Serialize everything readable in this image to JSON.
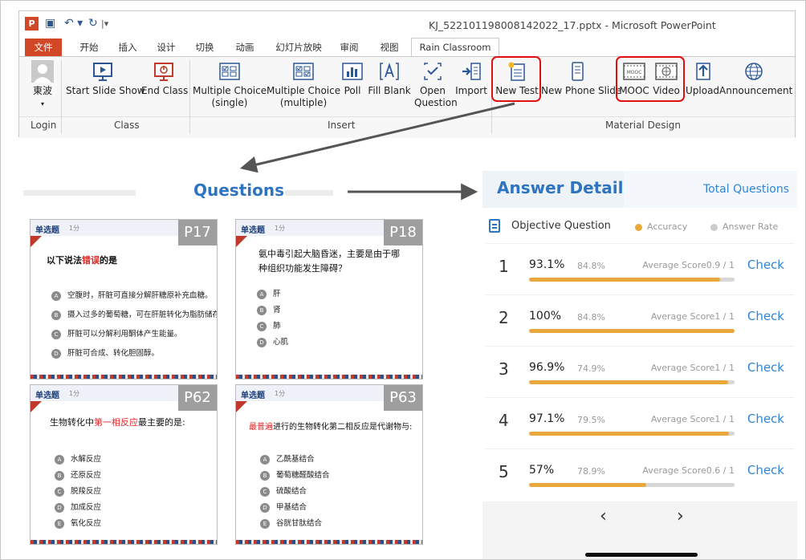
{
  "window": {
    "app_icon": "P",
    "title": "KJ_522101198008142022_17.pptx - Microsoft PowerPoint",
    "qa_save": "▣",
    "qa_undo": "↶ ▾",
    "qa_redo": "↻",
    "qa_more": "|▾"
  },
  "tabs": [
    "文件",
    "开始",
    "插入",
    "设计",
    "切换",
    "动画",
    "幻灯片放映",
    "审阅",
    "视图",
    "Rain Classroom"
  ],
  "ribbon": {
    "login_name": "東波",
    "login_arrow": "▾",
    "buttons": {
      "start_slide_show": "Start Slide Show",
      "end_class": "End Class",
      "mc_single_1": "Multiple Choice",
      "mc_single_2": "(single)",
      "mc_multiple_1": "Multiple Choice",
      "mc_multiple_2": "(multiple)",
      "poll": "Poll",
      "fill_blank": "Fill Blank",
      "open_question_1": "Open",
      "open_question_2": "Question",
      "import": "Import",
      "new_test": "New Test",
      "new_phone_slide": "New Phone Slide",
      "mooc": "MOOC",
      "video": "Video",
      "upload": "Upload",
      "announcement": "Announcement"
    },
    "groups": {
      "login": "Login",
      "class": "Class",
      "insert": "Insert",
      "material_design": "Material Design"
    }
  },
  "questions": {
    "title": "Questions",
    "slides": [
      {
        "tag": "P17",
        "type": "单选题",
        "score": "1分",
        "question_pre": "以下说法",
        "question_red": "错误",
        "question_post": "的是",
        "options": [
          {
            "letter": "A",
            "text": "空腹时，肝脏可直接分解肝糖原补充血糖。"
          },
          {
            "letter": "B",
            "text": "摄入过多的葡萄糖，可在肝脏转化为脂肪储存。"
          },
          {
            "letter": "C",
            "text": "肝脏可以分解利用酮体产生能量。"
          },
          {
            "letter": "D",
            "text": "肝脏可合成、转化胆固醇。"
          }
        ]
      },
      {
        "tag": "P18",
        "type": "单选题",
        "score": "1分",
        "question_pre": "氨中毒引起大脑昏迷，主要是由于哪种组织功能发生障碍？",
        "question_red": "",
        "question_post": "",
        "options": [
          {
            "letter": "A",
            "text": "肝"
          },
          {
            "letter": "B",
            "text": "肾"
          },
          {
            "letter": "C",
            "text": "肺"
          },
          {
            "letter": "D",
            "text": "心肌"
          }
        ]
      },
      {
        "tag": "P62",
        "type": "单选题",
        "score": "1分",
        "question_pre": "生物转化中",
        "question_red": "第一相反应",
        "question_post": "最主要的是:",
        "options": [
          {
            "letter": "A",
            "text": "水解反应"
          },
          {
            "letter": "B",
            "text": "还原反应"
          },
          {
            "letter": "C",
            "text": "脱羧反应"
          },
          {
            "letter": "D",
            "text": "加成反应"
          },
          {
            "letter": "E",
            "text": "氧化反应"
          }
        ]
      },
      {
        "tag": "P63",
        "type": "单选题",
        "score": "1分",
        "question_pre": "",
        "question_red": "最普遍",
        "question_post": "进行的生物转化第二相反应是代谢物与:",
        "options": [
          {
            "letter": "A",
            "text": "乙酰基结合"
          },
          {
            "letter": "B",
            "text": "葡萄糖醛酸结合"
          },
          {
            "letter": "C",
            "text": "硫酸结合"
          },
          {
            "letter": "D",
            "text": "甲基结合"
          },
          {
            "letter": "E",
            "text": "谷胱甘肽结合"
          }
        ]
      }
    ]
  },
  "answers": {
    "title": "Answer Details",
    "total_tab": "Total Questions",
    "objective_label": "Objective Question",
    "legend_accuracy": "Accuracy",
    "legend_rate": "Answer Rate",
    "accent_color": "#e8a93a",
    "rate_color": "#cccccc",
    "check_label": "Check",
    "rows": [
      {
        "num": "1",
        "accuracy": "93.1%",
        "rate": "84.8%",
        "avg": "Average Score0.9 / 1",
        "fill": 0.931
      },
      {
        "num": "2",
        "accuracy": "100%",
        "rate": "84.8%",
        "avg": "Average Score1 / 1",
        "fill": 1.0
      },
      {
        "num": "3",
        "accuracy": "96.9%",
        "rate": "74.9%",
        "avg": "Average Score1 / 1",
        "fill": 0.969
      },
      {
        "num": "4",
        "accuracy": "97.1%",
        "rate": "79.5%",
        "avg": "Average Score1 / 1",
        "fill": 0.971
      },
      {
        "num": "5",
        "accuracy": "57%",
        "rate": "78.9%",
        "avg": "Average Score0.6 / 1",
        "fill": 0.57
      }
    ],
    "prev": "‹",
    "next": "›"
  }
}
